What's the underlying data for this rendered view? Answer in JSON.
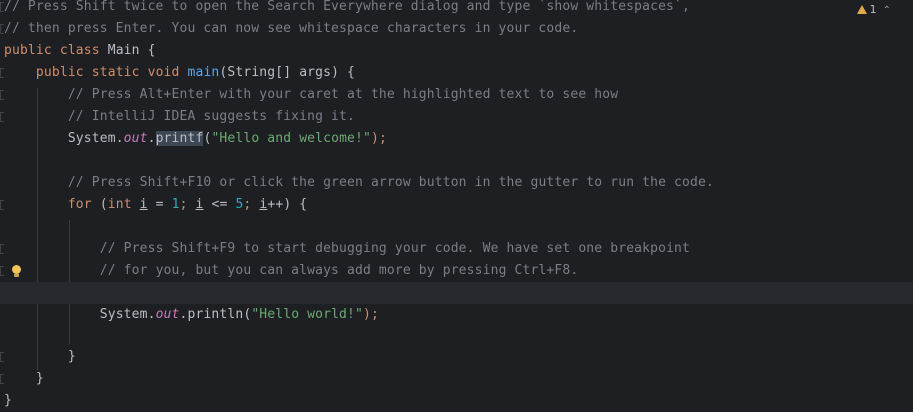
{
  "inspection": {
    "warning_count": "1",
    "warning_icon": "warning-triangle-icon",
    "nav_icon": "chevron-up-icon"
  },
  "lines": {
    "l1": "// Press Shift twice to open the Search Everywhere dialog and type `show whitespaces`,",
    "l2": "// then press Enter. You can now see whitespace characters in your code.",
    "l3_kw": "public class",
    "l3_rest": " Main {",
    "l4_kw": "public static void",
    "l4_fn": "main",
    "l4_rest": "(String[] args) {",
    "l5": "// Press Alt+Enter with your caret at the highlighted text to see how",
    "l6": "// IntelliJ IDEA suggests fixing it.",
    "l7_cls": "System.",
    "l7_fld": "out",
    "l7_dot": ".",
    "l7_fn": "printf",
    "l7_open": "(",
    "l7_str": "\"Hello and welcome!\"",
    "l7_close": ");",
    "l9": "// Press Shift+F10 or click the green arrow button in the gutter to run the code.",
    "l10_kw": "for",
    "l10_a": " (",
    "l10_int": "int",
    "l10_sp": " ",
    "l10_i1": "i",
    "l10_eq": " = ",
    "l10_n1": "1",
    "l10_semi1": "; ",
    "l10_i2": "i",
    "l10_le": " <= ",
    "l10_n2": "5",
    "l10_semi2": "; ",
    "l10_i3": "i",
    "l10_inc": "++) {",
    "l12": "// Press Shift+F9 to start debugging your code. We have set one breakpoint",
    "l13": "// for you, but you can always add more by pressing Ctrl+F8.",
    "l15_cls": "System.",
    "l15_fld": "out",
    "l15_fn": ".println(",
    "l15_str": "\"Hello world!\"",
    "l15_close": ");",
    "l17": "}",
    "l18": "}",
    "l19": "}"
  },
  "gutter": {
    "bulb_icon": "lightbulb-icon"
  }
}
